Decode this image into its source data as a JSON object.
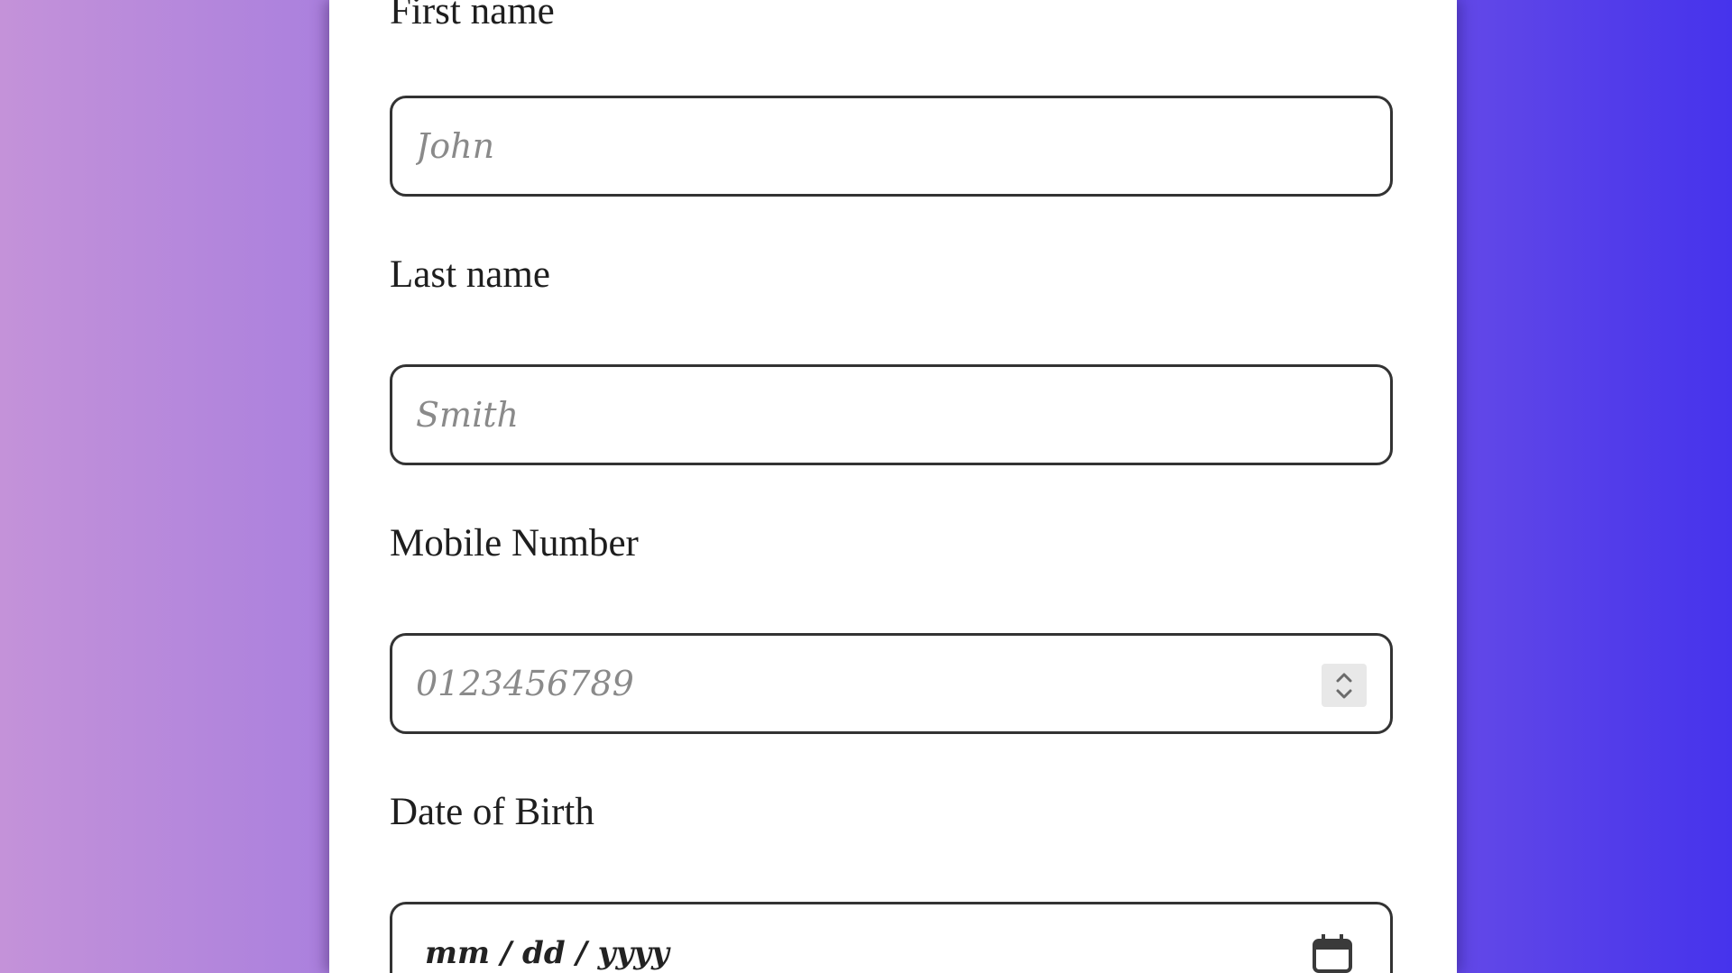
{
  "form": {
    "first_name": {
      "label": "First name",
      "placeholder": "John"
    },
    "last_name": {
      "label": "Last name",
      "placeholder": "Smith"
    },
    "mobile": {
      "label": "Mobile Number",
      "placeholder": "0123456789",
      "spinner_icon": "up-down-spinner-icon"
    },
    "dob": {
      "label": "Date of Birth",
      "placeholder": "mm / dd / yyyy",
      "icon": "calendar-icon"
    }
  },
  "colors": {
    "background_left": "#c492d9",
    "background_right": "#4633ec",
    "card": "#ffffff",
    "field_border": "#333333"
  }
}
